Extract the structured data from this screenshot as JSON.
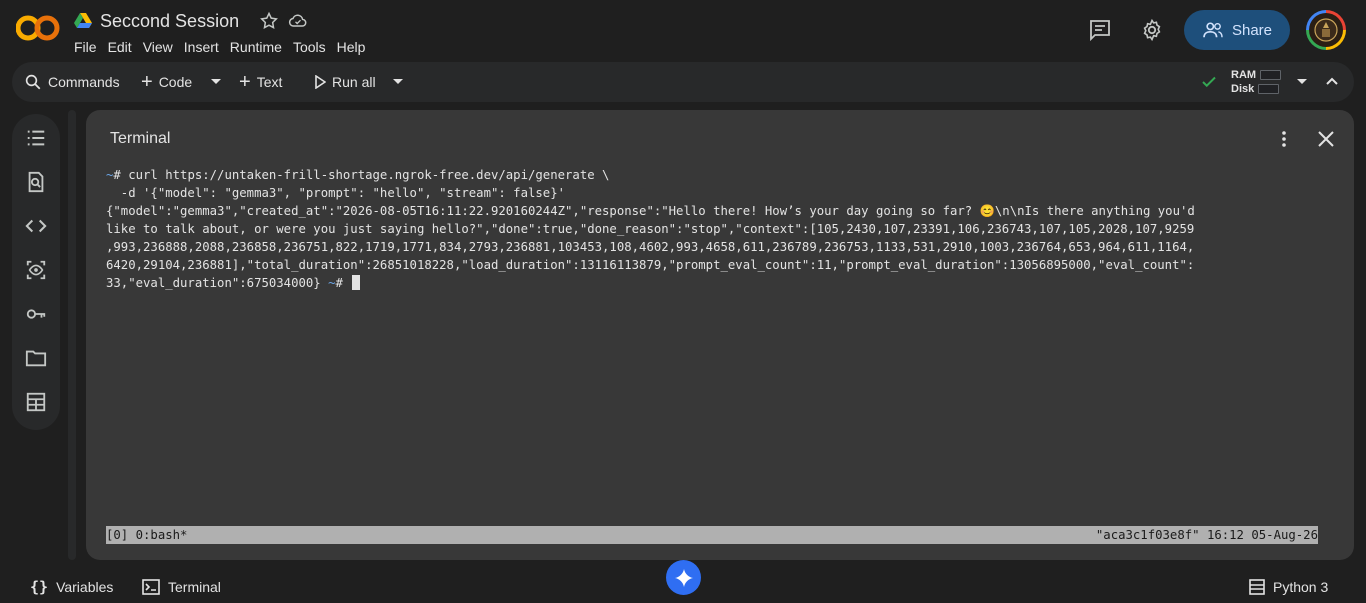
{
  "app": {
    "doc_title": "Seccond Session",
    "menu": [
      "File",
      "Edit",
      "View",
      "Insert",
      "Runtime",
      "Tools",
      "Help"
    ]
  },
  "header": {
    "share_label": "Share"
  },
  "toolbar": {
    "commands_label": "Commands",
    "code_label": "Code",
    "text_label": "Text",
    "run_all_label": "Run all",
    "ram_label": "RAM",
    "disk_label": "Disk"
  },
  "terminal": {
    "title": "Terminal",
    "lines": [
      {
        "prompt": "~",
        "text": "# curl https://untaken-frill-shortage.ngrok-free.dev/api/generate \\"
      },
      {
        "prompt": "",
        "text": "  -d '{\"model\": \"gemma3\", \"prompt\": \"hello\", \"stream\": false}'"
      },
      {
        "prompt": "",
        "text": "{\"model\":\"gemma3\",\"created_at\":\"2026-08-05T16:11:22.920160244Z\",\"response\":\"Hello there! How’s your day going so far? 😊\\n\\nIs there anything you'd"
      },
      {
        "prompt": "",
        "text": "like to talk about, or were you just saying hello?\",\"done\":true,\"done_reason\":\"stop\",\"context\":[105,2430,107,23391,106,236743,107,105,2028,107,9259"
      },
      {
        "prompt": "",
        "text": ",993,236888,2088,236858,236751,822,1719,1771,834,2793,236881,103453,108,4602,993,4658,611,236789,236753,1133,531,2910,1003,236764,653,964,611,1164,"
      },
      {
        "prompt": "",
        "text": "6420,29104,236881],\"total_duration\":26851018228,\"load_duration\":13116113879,\"prompt_eval_count\":11,\"prompt_eval_duration\":13056895000,\"eval_count\":"
      },
      {
        "prompt": "",
        "text": "33,\"eval_duration\":675034000} "
      }
    ],
    "final_prompt": "~",
    "final_hash": "# ",
    "status_left": "[0] 0:bash*",
    "status_right": "\"aca3c1f03e8f\" 16:12 05-Aug-26"
  },
  "bottom": {
    "variables_label": "Variables",
    "terminal_label": "Terminal",
    "runtime_label": "Python 3"
  },
  "colors": {
    "accent_blue": "#1e4f7b",
    "check_green": "#34a853",
    "prompt_blue": "#6ba6e8"
  }
}
